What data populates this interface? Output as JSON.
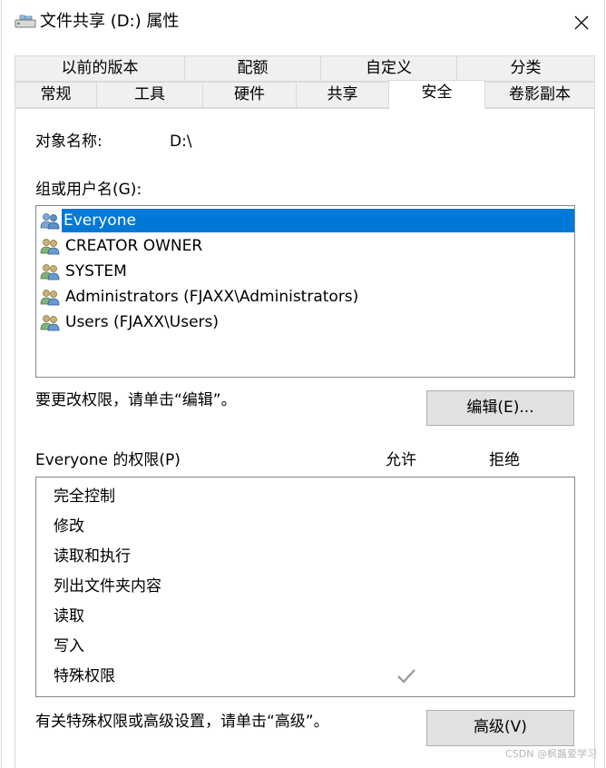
{
  "window": {
    "title": "文件共享 (D:) 属性",
    "close_glyph": "✕"
  },
  "tabs_row1": [
    "以前的版本",
    "配额",
    "自定义",
    "分类"
  ],
  "tabs_row2": [
    "常规",
    "工具",
    "硬件",
    "共享",
    "安全",
    "卷影副本"
  ],
  "active_tab": "安全",
  "object": {
    "label": "对象名称:",
    "value": "D:\\"
  },
  "groups": {
    "label": "组或用户名(G):",
    "items": [
      {
        "name": "Everyone",
        "selected": true,
        "icon": "users-group-icon"
      },
      {
        "name": "CREATOR OWNER",
        "selected": false,
        "icon": "users-group-icon"
      },
      {
        "name": "SYSTEM",
        "selected": false,
        "icon": "users-group-icon"
      },
      {
        "name": "Administrators (FJAXX\\Administrators)",
        "selected": false,
        "icon": "users-group-icon"
      },
      {
        "name": "Users (FJAXX\\Users)",
        "selected": false,
        "icon": "users-group-icon"
      }
    ]
  },
  "edit_hint": "要更改权限，请单击“编辑”。",
  "edit_button": "编辑(E)...",
  "permissions": {
    "label": "Everyone 的权限(P)",
    "allow_header": "允许",
    "deny_header": "拒绝",
    "rows": [
      {
        "name": "完全控制",
        "allow": false,
        "deny": false
      },
      {
        "name": "修改",
        "allow": false,
        "deny": false
      },
      {
        "name": "读取和执行",
        "allow": false,
        "deny": false
      },
      {
        "name": "列出文件夹内容",
        "allow": false,
        "deny": false
      },
      {
        "name": "读取",
        "allow": false,
        "deny": false
      },
      {
        "name": "写入",
        "allow": false,
        "deny": false
      },
      {
        "name": "特殊权限",
        "allow": true,
        "deny": false
      }
    ]
  },
  "advanced_hint": "有关特殊权限或高级设置，请单击“高级”。",
  "advanced_button": "高级(V)",
  "watermark": "CSDN @枫醬爱学习",
  "colors": {
    "selection": "#0078d7",
    "button_face": "#e1e1e1",
    "tab_inactive": "#f0f0f0",
    "checkmark_disabled": "#a0a0a0"
  }
}
